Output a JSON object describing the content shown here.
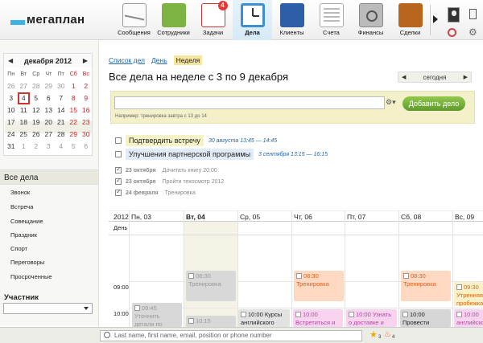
{
  "app": {
    "logo_text": "мегаплан"
  },
  "nav": [
    {
      "label": "Сообщения",
      "icon": "messages-icon"
    },
    {
      "label": "Сотрудники",
      "icon": "employees-icon"
    },
    {
      "label": "Задачи",
      "icon": "tasks-icon",
      "badge": "4"
    },
    {
      "label": "Дела",
      "icon": "clock-icon",
      "active": true
    },
    {
      "label": "Клиенты",
      "icon": "clients-icon"
    },
    {
      "label": "Счета",
      "icon": "bills-icon"
    },
    {
      "label": "Финансы",
      "icon": "finance-safe-icon"
    },
    {
      "label": "Сделки",
      "icon": "deals-briefcase-icon"
    }
  ],
  "calendar": {
    "title": "декабря 2012",
    "prev": "◀",
    "next": "▶",
    "weekdays": [
      "Пн",
      "Вт",
      "Ср",
      "Чт",
      "Пт",
      "Сб",
      "Вс"
    ],
    "weeks": [
      [
        "26",
        "27",
        "28",
        "29",
        "30",
        "1",
        "2"
      ],
      [
        "3",
        "4",
        "5",
        "6",
        "7",
        "8",
        "9"
      ],
      [
        "10",
        "11",
        "12",
        "13",
        "14",
        "15",
        "16"
      ],
      [
        "17",
        "18",
        "19",
        "20",
        "21",
        "22",
        "23"
      ],
      [
        "24",
        "25",
        "26",
        "27",
        "28",
        "29",
        "30"
      ],
      [
        "31",
        "1",
        "2",
        "3",
        "4",
        "5",
        "6"
      ]
    ],
    "today": "4"
  },
  "sidebar": {
    "title": "Все дела",
    "items": [
      "Звонок",
      "Встреча",
      "Совещание",
      "Праздник",
      "Спорт",
      "Переговоры",
      "Просроченные"
    ],
    "participant_title": "Участник",
    "participant_value": ""
  },
  "main": {
    "links": {
      "list": "Список дел",
      "day": "День",
      "week": "Неделя"
    },
    "title": "Все дела  на неделе с 3 по 9 декабря",
    "today_label": "сегодня",
    "prev": "◀",
    "next": "▶",
    "add": {
      "input_value": "",
      "button": "Добавить дело",
      "hint": "Например: тренировка завтра с 13 до 14"
    },
    "tasks": [
      {
        "title": "Подтвердить встречу",
        "when": "30 августа 13:45 — 14:45",
        "color": "#f6f2c8"
      },
      {
        "title": "Улучшения партнерской программы",
        "when": "3 сентября 13:15 — 16:15",
        "color": "#e1ecf8"
      }
    ],
    "done": [
      {
        "date": "23 октября",
        "text": "Дочитать книгу 20:00"
      },
      {
        "date": "23 октября",
        "text": "Пройти техосмотр 2012"
      },
      {
        "date": "24 февраля",
        "text": "Тренировка"
      }
    ]
  },
  "week": {
    "year": "2012",
    "days": [
      "Пн, 03",
      "Вт, 04",
      "Ср, 05",
      "Чт, 06",
      "Пт, 07",
      "Сб, 08",
      "Вс, 09"
    ],
    "allday_label": "День",
    "hours": [
      "09:00",
      "10:00"
    ],
    "events": [
      {
        "day": "Вт",
        "time": "08:30",
        "title": "Тренировка",
        "style": "ev-grey"
      },
      {
        "day": "Чт",
        "time": "08:30",
        "title": "Тренировка",
        "style": "ev-orange"
      },
      {
        "day": "Сб",
        "time": "08:30",
        "title": "Тренировка",
        "style": "ev-orange"
      },
      {
        "day": "Пн",
        "time": "09:45",
        "title": "Уточнить детали по проекту",
        "style": "ev-grey"
      },
      {
        "day": "Вт",
        "time": "10:15",
        "title": "",
        "style": "ev-grey"
      },
      {
        "day": "Ср",
        "time": "10:00",
        "title": "Курсы английского",
        "style": "ev-white"
      },
      {
        "day": "Чт",
        "time": "10:00",
        "title": "Встретиться и",
        "style": "ev-pink"
      },
      {
        "day": "Пт",
        "time": "10:00",
        "title": "Узнать о доставке и",
        "style": "ev-pink"
      },
      {
        "day": "Сб",
        "time": "10:00",
        "title": "Провести",
        "style": "ev-grey2"
      },
      {
        "day": "Вс",
        "time": "09:30",
        "title": "Утренняя пробежка",
        "style": "ev-yellow"
      },
      {
        "day": "Вс",
        "time": "10:00",
        "title": "английского",
        "style": "ev-pink"
      }
    ]
  },
  "bottom": {
    "search_placeholder": "Last name, first name, email, position or phone number",
    "stars": "3",
    "fires": "4"
  }
}
